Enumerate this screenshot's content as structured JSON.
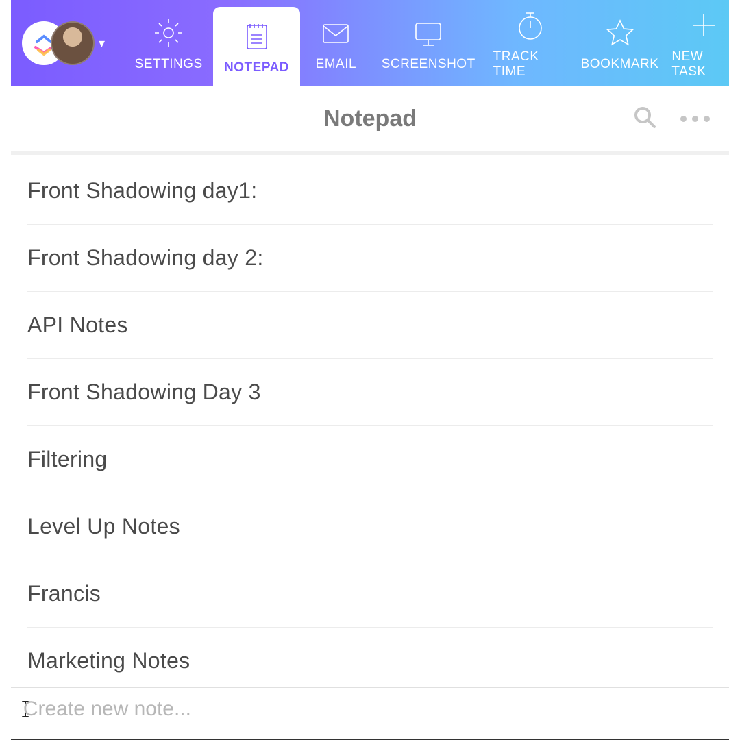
{
  "header": {
    "tabs": [
      {
        "id": "settings",
        "label": "SETTINGS",
        "icon": "gear-icon",
        "active": false
      },
      {
        "id": "notepad",
        "label": "NOTEPAD",
        "icon": "notepad-icon",
        "active": true
      },
      {
        "id": "email",
        "label": "EMAIL",
        "icon": "envelope-icon",
        "active": false
      },
      {
        "id": "screenshot",
        "label": "SCREENSHOT",
        "icon": "monitor-icon",
        "active": false
      },
      {
        "id": "tracktime",
        "label": "TRACK TIME",
        "icon": "stopwatch-icon",
        "active": false
      },
      {
        "id": "bookmark",
        "label": "BOOKMARK",
        "icon": "star-icon",
        "active": false
      },
      {
        "id": "newtask",
        "label": "NEW TASK",
        "icon": "plus-icon",
        "active": false
      }
    ]
  },
  "subheader": {
    "title": "Notepad"
  },
  "notes": [
    {
      "title": "Front Shadowing day1:"
    },
    {
      "title": "Front Shadowing day 2:"
    },
    {
      "title": "API Notes"
    },
    {
      "title": "Front Shadowing Day 3"
    },
    {
      "title": "Filtering"
    },
    {
      "title": "Level Up Notes"
    },
    {
      "title": "Francis"
    },
    {
      "title": "Marketing Notes"
    }
  ],
  "create": {
    "placeholder": "Create new note..."
  }
}
